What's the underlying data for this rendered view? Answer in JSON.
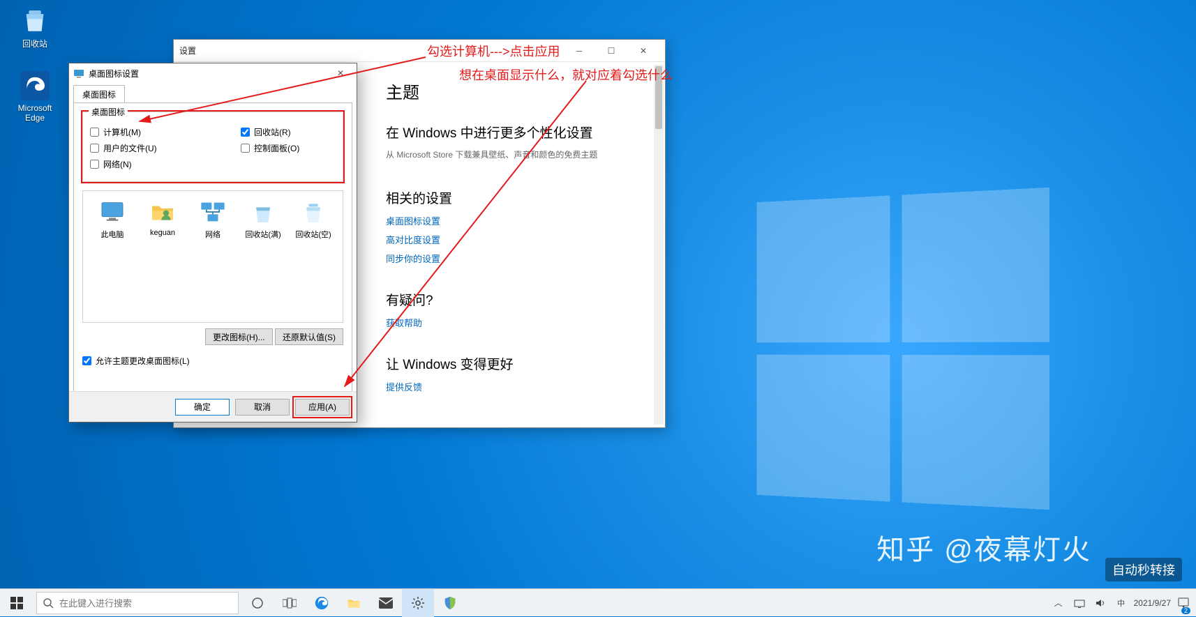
{
  "desktop": {
    "icons": [
      {
        "name": "recycle-bin",
        "label": "回收站"
      },
      {
        "name": "edge",
        "label": "Microsoft Edge"
      }
    ]
  },
  "settings_window": {
    "title": "设置",
    "heading": "主题",
    "section_more": "在 Windows 中进行更多个性化设置",
    "section_more_sub": "从 Microsoft Store 下载兼具壁纸、声音和颜色的免费主题",
    "section_related": "相关的设置",
    "links": {
      "desktop_icon": "桌面图标设置",
      "high_contrast": "高对比度设置",
      "sync": "同步你的设置"
    },
    "section_help": "有疑问?",
    "link_help": "获取帮助",
    "section_better": "让 Windows 变得更好",
    "link_feedback": "提供反馈"
  },
  "dialog": {
    "title": "桌面图标设置",
    "tab": "桌面图标",
    "group_label": "桌面图标",
    "checks": {
      "computer": "计算机(M)",
      "recycle": "回收站(R)",
      "userfiles": "用户的文件(U)",
      "control_panel": "控制面板(O)",
      "network": "网络(N)"
    },
    "preview": {
      "this_pc": "此电脑",
      "keguan": "keguan",
      "network": "网络",
      "recycle_full": "回收站(满)",
      "recycle_empty": "回收站(空)"
    },
    "btn_change_icon": "更改图标(H)...",
    "btn_restore": "还原默认值(S)",
    "allow_theme": "允许主题更改桌面图标(L)",
    "btn_ok": "确定",
    "btn_cancel": "取消",
    "btn_apply": "应用(A)"
  },
  "annotation": {
    "line1": "勾选计算机--->点击应用",
    "line2": "想在桌面显示什么，就对应着勾选什么"
  },
  "taskbar": {
    "search_placeholder": "在此键入进行搜索",
    "date": "2021/9/27",
    "notif_count": "2"
  },
  "watermark": {
    "zhihu": "知乎 @夜幕灯火",
    "small": "自动秒转接"
  }
}
